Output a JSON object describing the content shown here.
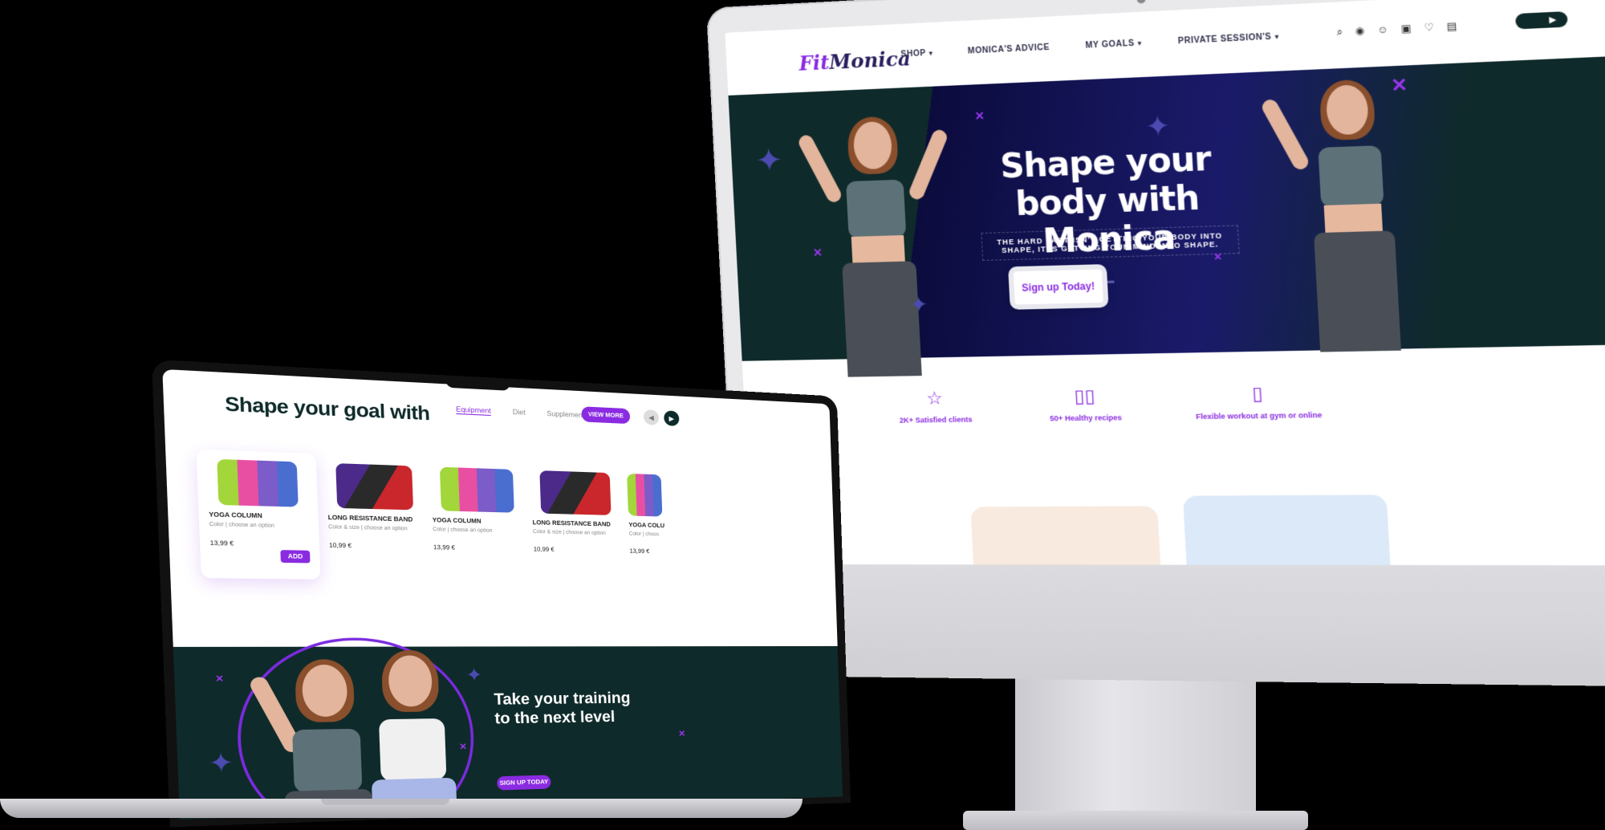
{
  "desktop": {
    "logo": {
      "fit": "Fit",
      "name": "Monica"
    },
    "nav": [
      {
        "label": "SHOP",
        "dropdown": true
      },
      {
        "label": "MONICA'S ADVICE",
        "dropdown": false
      },
      {
        "label": "MY GOALS",
        "dropdown": true
      },
      {
        "label": "PRIVATE SESSION'S",
        "dropdown": true
      }
    ],
    "header_icons": [
      "search-icon",
      "flag-icon",
      "user-icon",
      "bag-icon",
      "heart-icon",
      "cart-icon"
    ],
    "store_icons": [
      "apple-icon",
      "play-icon"
    ],
    "hero": {
      "title": "Shape your body with Monica",
      "subtitle": "THE HARD PART ISN'T GETTING YOUR BODY INTO SHAPE, IT IS GETTING YOUR MIND INTO SHAPE.",
      "slides": 3,
      "active_slide": 1
    },
    "cta": "Sign up Today!",
    "features": [
      {
        "icon": "star-icon",
        "label": "2K+ Satisfied clients"
      },
      {
        "icon": "book-icon",
        "label": "50+ Healthy recipes"
      },
      {
        "icon": "phone-icon",
        "label": "Flexible workout at gym or online"
      }
    ]
  },
  "laptop": {
    "title": "Shape your goal with",
    "tabs": [
      {
        "label": "Equipment",
        "active": true
      },
      {
        "label": "Diet",
        "active": false
      },
      {
        "label": "Supplements",
        "active": false
      }
    ],
    "view_more": "VIEW MORE",
    "products": [
      {
        "name": "YOGA COLUMN",
        "option_label": "Color",
        "option_value": "choose an option",
        "price": "13,99 €",
        "image": "yoga",
        "highlight": true,
        "add": "ADD"
      },
      {
        "name": "LONG RESISTANCE BAND",
        "option_label": "Color & size",
        "option_value": "choose an option",
        "price": "10,99 €",
        "image": "band",
        "highlight": false
      },
      {
        "name": "YOGA COLUMN",
        "option_label": "Color",
        "option_value": "choose an option",
        "price": "13,99 €",
        "image": "yoga",
        "highlight": false
      },
      {
        "name": "LONG RESISTANCE BAND",
        "option_label": "Color & size",
        "option_value": "choose an option",
        "price": "10,99 €",
        "image": "band",
        "highlight": false
      },
      {
        "name": "YOGA COLU",
        "option_label": "Color",
        "option_value": "choos",
        "price": "13,99 €",
        "image": "yoga",
        "highlight": false
      }
    ],
    "banner": {
      "title": "Take your training to the next level",
      "button": "SIGN UP TODAY"
    }
  },
  "colors": {
    "accent": "#8a2be2",
    "dark_teal": "#0f2a2a",
    "navy": "#0b0b3d"
  }
}
